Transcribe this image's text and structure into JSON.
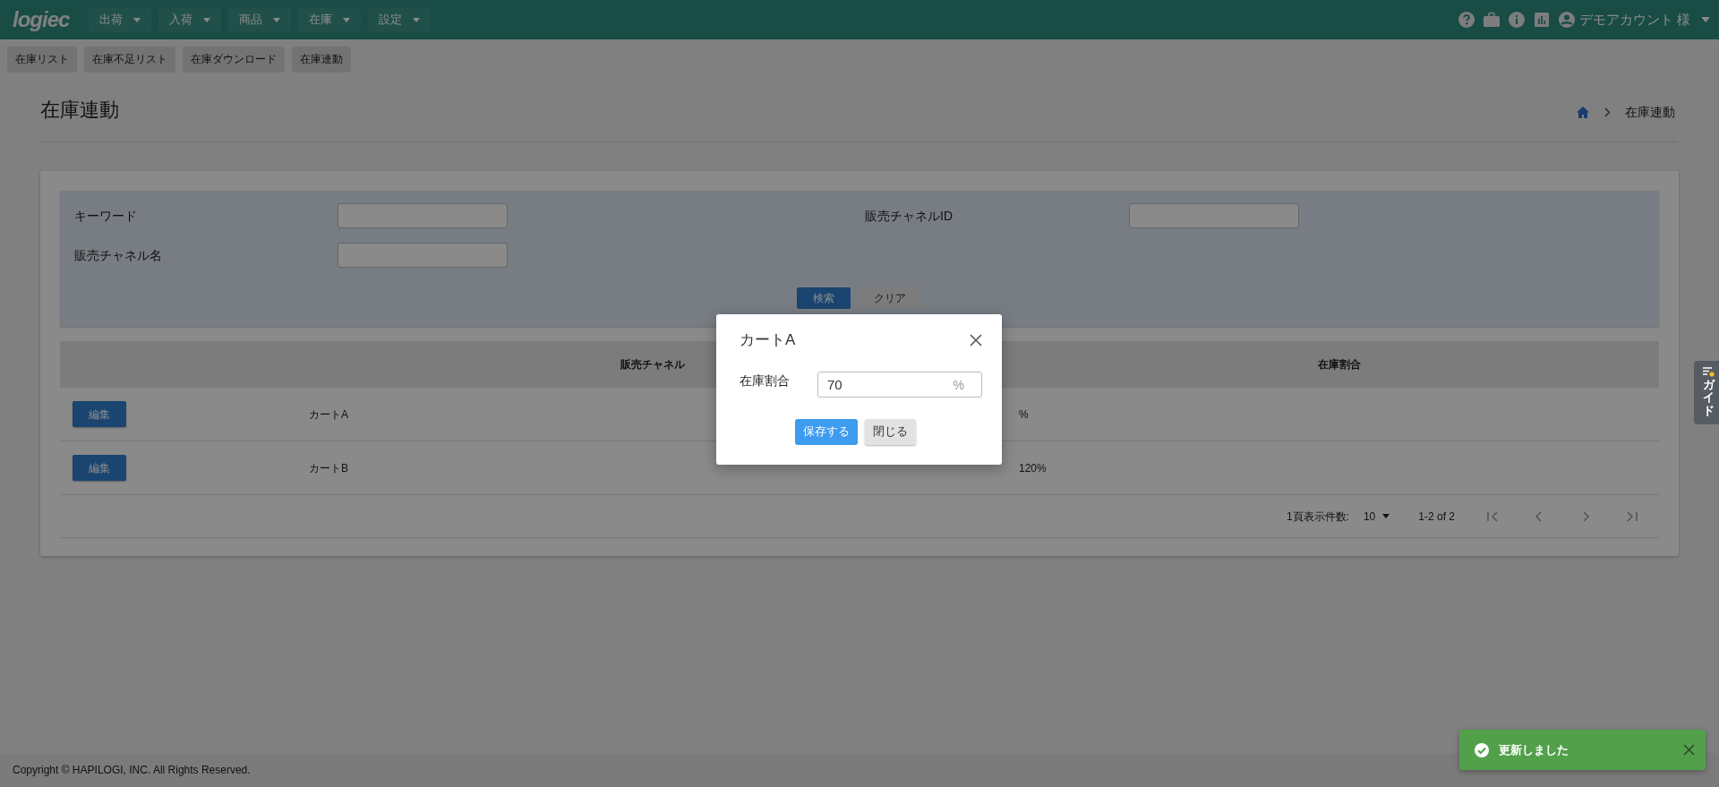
{
  "header": {
    "logo": "logiec",
    "menus": [
      {
        "label": "出荷"
      },
      {
        "label": "入荷"
      },
      {
        "label": "商品"
      },
      {
        "label": "在庫"
      },
      {
        "label": "設定"
      }
    ],
    "user": "デモアカウント 様"
  },
  "subnav": [
    {
      "label": "在庫リスト"
    },
    {
      "label": "在庫不足リスト"
    },
    {
      "label": "在庫ダウンロード"
    },
    {
      "label": "在庫連動"
    }
  ],
  "page": {
    "title": "在庫連動",
    "breadcrumb": "在庫連動"
  },
  "search": {
    "fields": [
      {
        "label": "キーワード"
      },
      {
        "label": "販売チャネルID"
      },
      {
        "label": "販売チャネル名"
      }
    ],
    "buttons": [
      {
        "label": "検索",
        "kind": "primary"
      },
      {
        "label": "クリア",
        "kind": "secondary"
      }
    ]
  },
  "table": {
    "columns": [
      "販売チャネル",
      "在庫割合"
    ],
    "rows": [
      {
        "action": "編集",
        "channel": "カートA",
        "rate": "%"
      },
      {
        "action": "編集",
        "channel": "カートB",
        "rate": "120%"
      }
    ]
  },
  "pagination": {
    "per_page_label": "1頁表示件数:",
    "per_page": "10",
    "range": "1-2 of 2"
  },
  "modal": {
    "title": "カートA",
    "field_label": "在庫割合",
    "value": "70",
    "suffix": "%",
    "buttons": [
      {
        "label": "保存する",
        "kind": "primary"
      },
      {
        "label": "閉じる",
        "kind": "secondary"
      }
    ]
  },
  "toast": {
    "message": "更新しました"
  },
  "guide_tab": {
    "label": "ガイド"
  },
  "footer": "Copyright © HAPILOGI, INC. All Rights Reserved."
}
